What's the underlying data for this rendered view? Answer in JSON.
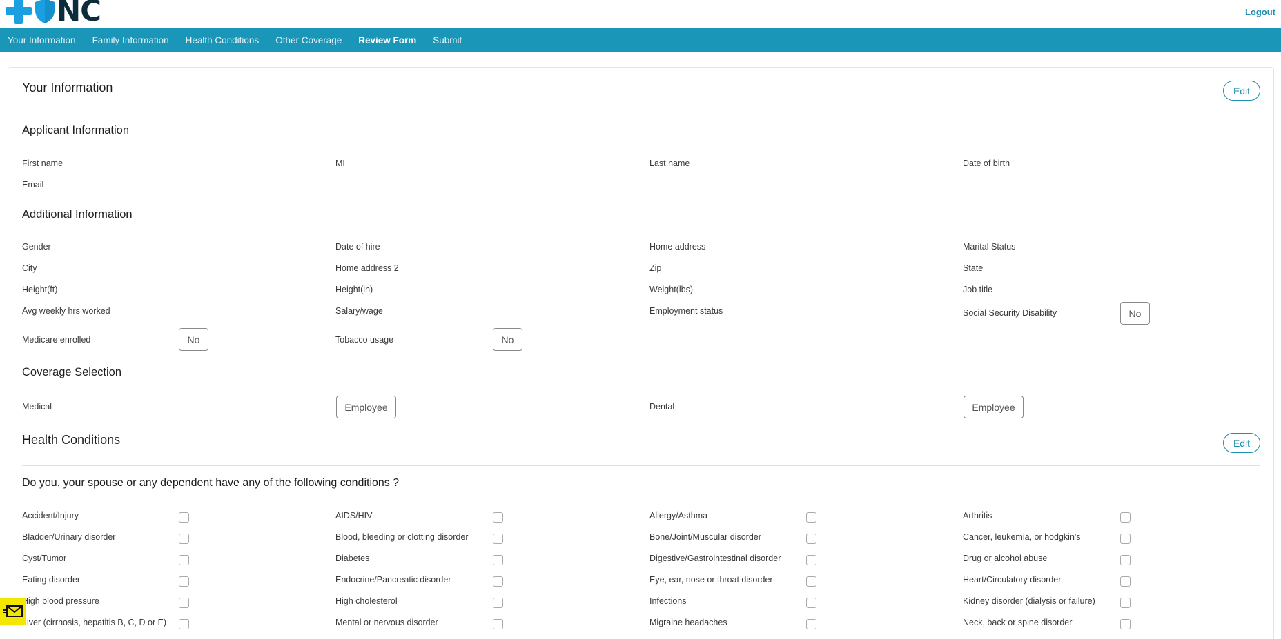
{
  "header": {
    "logo_text": "NC",
    "logout_label": "Logout",
    "brand_colors": {
      "cross": "#1aa0e0",
      "text": "#0c2c3c",
      "nav": "#1a96b8",
      "accent": "#1a8db0"
    }
  },
  "nav": {
    "items": [
      {
        "label": "Your Information"
      },
      {
        "label": "Family Information"
      },
      {
        "label": "Health Conditions"
      },
      {
        "label": "Other Coverage"
      },
      {
        "label": "Review Form",
        "active": true
      },
      {
        "label": "Submit"
      }
    ]
  },
  "your_information": {
    "title": "Your Information",
    "edit_label": "Edit",
    "applicant": {
      "title": "Applicant Information",
      "first_name": "First name",
      "mi": "MI",
      "last_name": "Last name",
      "dob": "Date of birth",
      "email": "Email"
    },
    "additional": {
      "title": "Additional Information",
      "gender": "Gender",
      "date_of_hire": "Date of hire",
      "home_address": "Home address",
      "marital_status": "Marital Status",
      "city": "City",
      "home_address_2": "Home address 2",
      "zip": "Zip",
      "state": "State",
      "height_ft": "Height(ft)",
      "height_in": "Height(in)",
      "weight": "Weight(lbs)",
      "job_title": "Job title",
      "avg_hours": "Avg weekly hrs worked",
      "salary": "Salary/wage",
      "employment_status": "Employment status",
      "ssd_label": "Social Security Disability",
      "ssd_value": "No",
      "medicare_label": "Medicare enrolled",
      "medicare_value": "No",
      "tobacco_label": "Tobacco usage",
      "tobacco_value": "No"
    },
    "coverage": {
      "title": "Coverage Selection",
      "medical_label": "Medical",
      "medical_value": "Employee",
      "dental_label": "Dental",
      "dental_value": "Employee"
    }
  },
  "health_conditions": {
    "title": "Health Conditions",
    "edit_label": "Edit",
    "question": "Do you, your spouse or any dependent have any of the following conditions ?",
    "rows": [
      [
        "Accident/Injury",
        "AIDS/HIV",
        "Allergy/Asthma",
        "Arthritis"
      ],
      [
        "Bladder/Urinary disorder",
        "Blood, bleeding or clotting disorder",
        "Bone/Joint/Muscular disorder",
        "Cancer, leukemia, or hodgkin's"
      ],
      [
        "Cyst/Tumor",
        "Diabetes",
        "Digestive/Gastrointestinal disorder",
        "Drug or alcohol abuse"
      ],
      [
        "Eating disorder",
        "Endocrine/Pancreatic disorder",
        "Eye, ear, nose or throat disorder",
        "Heart/Circulatory disorder"
      ],
      [
        "High blood pressure",
        "High cholesterol",
        "Infections",
        "Kidney disorder (dialysis or failure)"
      ],
      [
        "Liver (cirrhosis, hepatitis B, C, D or E)",
        "Mental or nervous disorder",
        "Migraine headaches",
        "Neck, back or spine disorder"
      ]
    ]
  },
  "icons": {
    "mail": "mail-icon",
    "shield": "shield-icon",
    "cross": "cross-icon"
  }
}
